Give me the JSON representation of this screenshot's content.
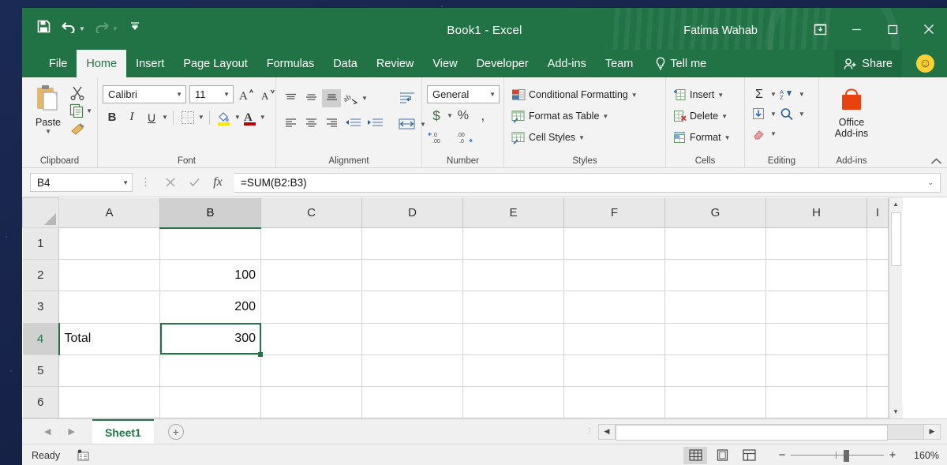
{
  "window": {
    "title": "Book1  -  Excel",
    "account": "Fatima Wahab",
    "ribbon_display_icon": "ribbon-display-options-icon",
    "minimize_icon": "minimize-icon",
    "maximize_icon": "maximize-icon",
    "close_icon": "close-icon"
  },
  "quick_access": {
    "save_label": "save-icon",
    "undo_label": "undo-icon",
    "redo_label": "redo-icon",
    "customize_label": "customize-quick-access-toolbar-icon"
  },
  "tabs": [
    {
      "label": "File",
      "active": false
    },
    {
      "label": "Home",
      "active": true
    },
    {
      "label": "Insert",
      "active": false
    },
    {
      "label": "Page Layout",
      "active": false
    },
    {
      "label": "Formulas",
      "active": false
    },
    {
      "label": "Data",
      "active": false
    },
    {
      "label": "Review",
      "active": false
    },
    {
      "label": "View",
      "active": false
    },
    {
      "label": "Developer",
      "active": false
    },
    {
      "label": "Add-ins",
      "active": false
    },
    {
      "label": "Team",
      "active": false
    }
  ],
  "tell_me": {
    "label": "Tell me",
    "icon": "lightbulb-icon"
  },
  "share": {
    "label": "Share",
    "icon": "share-person-icon"
  },
  "smiley": {
    "glyph": "☺"
  },
  "ribbon": {
    "clipboard": {
      "title": "Clipboard",
      "paste_label": "Paste",
      "cut_label": "cut-icon",
      "copy_label": "copy-icon",
      "format_painter_label": "format-painter-icon"
    },
    "font": {
      "title": "Font",
      "font_name": "Calibri",
      "font_size": "11",
      "grow_font": "A",
      "shrink_font": "A",
      "bold": "B",
      "italic": "I",
      "underline": "U",
      "borders": "borders-icon",
      "fill_color": "fill-color-icon",
      "font_color": "font-color-icon"
    },
    "alignment": {
      "title": "Alignment",
      "align_top": "align-top-icon",
      "align_middle": "align-middle-icon",
      "align_bottom": "align-bottom-icon",
      "orientation": "orientation-icon",
      "align_left": "align-left-icon",
      "align_center": "align-center-icon",
      "align_right": "align-right-icon",
      "decrease_indent": "decrease-indent-icon",
      "increase_indent": "increase-indent-icon",
      "wrap_text": "wrap-text-icon",
      "merge_center": "merge-and-center-icon"
    },
    "number": {
      "title": "Number",
      "format": "General",
      "currency": "$",
      "percent": "%",
      "comma": ",",
      "increase_decimal": "increase-decimal-icon",
      "decrease_decimal": "decrease-decimal-icon"
    },
    "styles": {
      "title": "Styles",
      "items": [
        {
          "label": "Conditional Formatting",
          "icon": "conditional-formatting-icon"
        },
        {
          "label": "Format as Table",
          "icon": "format-as-table-icon"
        },
        {
          "label": "Cell Styles",
          "icon": "cell-styles-icon"
        }
      ]
    },
    "cells": {
      "title": "Cells",
      "items": [
        {
          "label": "Insert",
          "icon": "insert-cells-icon"
        },
        {
          "label": "Delete",
          "icon": "delete-cells-icon"
        },
        {
          "label": "Format",
          "icon": "format-cells-icon"
        }
      ]
    },
    "editing": {
      "title": "Editing",
      "autosum": "Σ",
      "sort_filter": "sort-and-filter-icon",
      "fill": "fill-icon",
      "find_select": "find-and-select-icon",
      "clear": "clear-icon"
    },
    "addins": {
      "title": "Add-ins",
      "office_addins_line1": "Office",
      "office_addins_line2": "Add-ins"
    },
    "collapse": "collapse-ribbon-icon"
  },
  "formula_bar": {
    "name_box": "B4",
    "cancel_icon": "cancel-icon",
    "enter_icon": "enter-icon",
    "function_icon": "fx",
    "formula": "=SUM(B2:B3)",
    "expand_icon": "expand-formula-bar-icon"
  },
  "grid": {
    "columns": [
      "A",
      "B",
      "C",
      "D",
      "E",
      "F",
      "G",
      "H",
      "I"
    ],
    "selected_column": "B",
    "selected_row": "4",
    "rows": [
      {
        "num": "1",
        "cells": [
          "",
          "",
          "",
          "",
          "",
          "",
          "",
          "",
          ""
        ]
      },
      {
        "num": "2",
        "cells": [
          "",
          "100",
          "",
          "",
          "",
          "",
          "",
          "",
          ""
        ]
      },
      {
        "num": "3",
        "cells": [
          "",
          "200",
          "",
          "",
          "",
          "",
          "",
          "",
          ""
        ]
      },
      {
        "num": "4",
        "cells": [
          "Total",
          "300",
          "",
          "",
          "",
          "",
          "",
          "",
          ""
        ]
      },
      {
        "num": "5",
        "cells": [
          "",
          "",
          "",
          "",
          "",
          "",
          "",
          "",
          ""
        ]
      },
      {
        "num": "6",
        "cells": [
          "",
          "",
          "",
          "",
          "",
          "",
          "",
          "",
          ""
        ]
      }
    ],
    "numeric_columns": [
      1
    ],
    "selected_cell": {
      "row": 3,
      "col": 1
    }
  },
  "sheet_bar": {
    "prev_icon": "previous-sheet-icon",
    "next_icon": "next-sheet-icon",
    "sheets": [
      {
        "name": "Sheet1",
        "active": true
      }
    ],
    "add_sheet": "+"
  },
  "status_bar": {
    "state": "Ready",
    "macro_icon": "record-macro-icon",
    "views": [
      {
        "name": "normal-view",
        "active": true
      },
      {
        "name": "page-layout-view",
        "active": false
      },
      {
        "name": "page-break-preview",
        "active": false
      }
    ],
    "zoom_out": "−",
    "zoom_in": "+",
    "zoom_level": "160%"
  },
  "colors": {
    "excel_green": "#217346",
    "ribbon_bg": "#f3f3f3",
    "selection_green": "#217346",
    "fill_yellow": "#ffe600",
    "font_red": "#c00000",
    "addins_orange": "#e8430e"
  }
}
